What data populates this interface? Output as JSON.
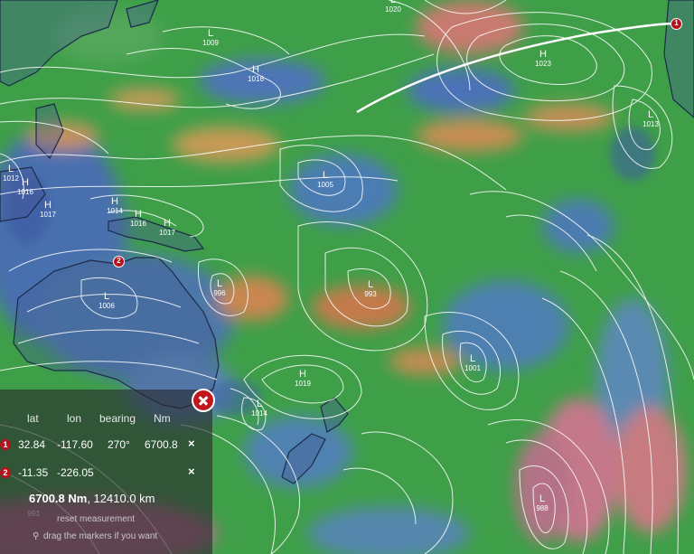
{
  "colors": {
    "ocean_base": "#3a9a4a",
    "land_outline": "#1c2b4a",
    "isobar": "#ffffff",
    "marker": "#b5121b"
  },
  "pressure_labels": [
    {
      "type": "L",
      "value": "1009"
    },
    {
      "type": "H",
      "value": "1016"
    },
    {
      "type": "H",
      "value": "1023"
    },
    {
      "type": "L",
      "value": "1020"
    },
    {
      "type": "L",
      "value": "1013"
    },
    {
      "type": "L",
      "value": "1012"
    },
    {
      "type": "H",
      "value": "1016"
    },
    {
      "type": "H",
      "value": "1017"
    },
    {
      "type": "H",
      "value": "1014"
    },
    {
      "type": "H",
      "value": "1016"
    },
    {
      "type": "H",
      "value": "1017"
    },
    {
      "type": "L",
      "value": "1005"
    },
    {
      "type": "L",
      "value": "996"
    },
    {
      "type": "L",
      "value": "993"
    },
    {
      "type": "L",
      "value": "1006"
    },
    {
      "type": "H",
      "value": "1019"
    },
    {
      "type": "L",
      "value": "1014"
    },
    {
      "type": "L",
      "value": "1001"
    },
    {
      "type": "L",
      "value": "988"
    },
    {
      "type": "",
      "value": "993"
    }
  ],
  "map_markers": [
    {
      "label": "1"
    },
    {
      "label": "2"
    }
  ],
  "measurement": {
    "headers": {
      "lat": "lat",
      "lon": "lon",
      "bearing": "bearing",
      "nm": "Nm"
    },
    "rows": [
      {
        "marker": "1",
        "lat": "32.84",
        "lon": "-117.60",
        "bearing": "270°",
        "nm": "6700.8",
        "remove": "×"
      },
      {
        "marker": "2",
        "lat": "-11.35",
        "lon": "-226.05",
        "bearing": "",
        "nm": "",
        "remove": "×"
      }
    ],
    "total_nm": "6700.8 Nm",
    "total_km": ", 12410.0 km",
    "reset_label": "reset measurement",
    "hint_label": "drag the markers if you want",
    "pin_icon": "⚲"
  }
}
